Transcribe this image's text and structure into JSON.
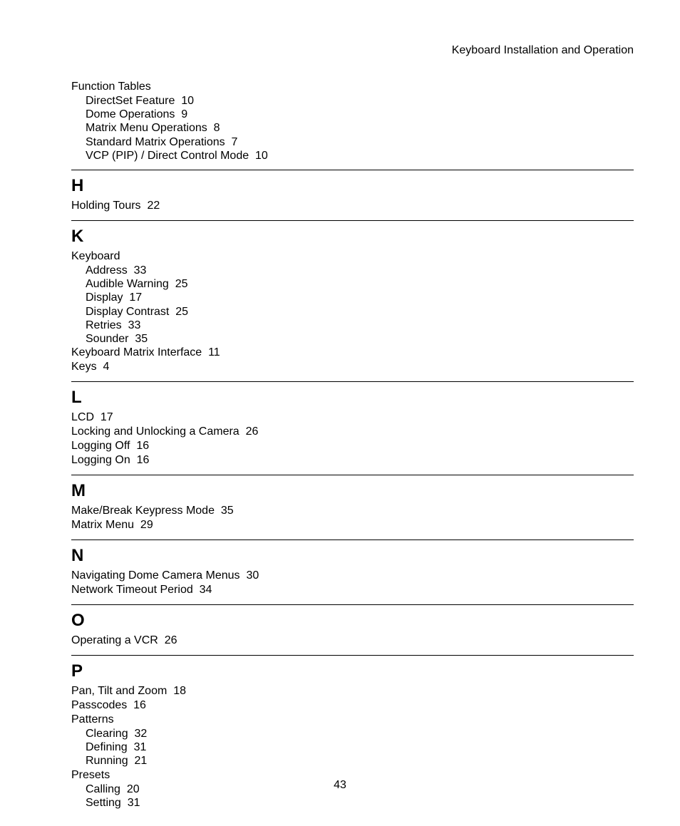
{
  "header": "Keyboard Installation and Operation",
  "pageNumber": "43",
  "top": {
    "title": "Function Tables",
    "subs": [
      {
        "label": "DirectSet Feature",
        "page": "10"
      },
      {
        "label": "Dome Operations",
        "page": "9"
      },
      {
        "label": "Matrix Menu Operations",
        "page": "8"
      },
      {
        "label": "Standard Matrix Operations",
        "page": "7"
      },
      {
        "label": "VCP (PIP) / Direct Control Mode",
        "page": "10"
      }
    ]
  },
  "sections": {
    "H": {
      "letter": "H",
      "entries": [
        {
          "label": "Holding Tours",
          "page": "22"
        }
      ]
    },
    "K": {
      "letter": "K",
      "entries": [
        {
          "label": "Keyboard",
          "subs": [
            {
              "label": "Address",
              "page": "33"
            },
            {
              "label": "Audible Warning",
              "page": "25"
            },
            {
              "label": "Display",
              "page": "17"
            },
            {
              "label": "Display Contrast",
              "page": "25"
            },
            {
              "label": "Retries",
              "page": "33"
            },
            {
              "label": "Sounder",
              "page": "35"
            }
          ]
        },
        {
          "label": "Keyboard Matrix Interface",
          "page": "11"
        },
        {
          "label": "Keys",
          "page": "4"
        }
      ]
    },
    "L": {
      "letter": "L",
      "entries": [
        {
          "label": "LCD",
          "page": "17"
        },
        {
          "label": "Locking and Unlocking a Camera",
          "page": "26"
        },
        {
          "label": "Logging Off",
          "page": "16"
        },
        {
          "label": "Logging On",
          "page": "16"
        }
      ]
    },
    "M": {
      "letter": "M",
      "entries": [
        {
          "label": "Make/Break Keypress Mode",
          "page": "35"
        },
        {
          "label": "Matrix Menu",
          "page": "29"
        }
      ]
    },
    "N": {
      "letter": "N",
      "entries": [
        {
          "label": "Navigating Dome Camera Menus",
          "page": "30"
        },
        {
          "label": "Network Timeout Period",
          "page": "34"
        }
      ]
    },
    "O": {
      "letter": "O",
      "entries": [
        {
          "label": "Operating a VCR",
          "page": "26"
        }
      ]
    },
    "P": {
      "letter": "P",
      "entries": [
        {
          "label": "Pan, Tilt and Zoom",
          "page": "18"
        },
        {
          "label": "Passcodes",
          "page": "16"
        },
        {
          "label": "Patterns",
          "subs": [
            {
              "label": "Clearing",
              "page": "32"
            },
            {
              "label": "Defining",
              "page": "31"
            },
            {
              "label": "Running",
              "page": "21"
            }
          ]
        },
        {
          "label": "Presets",
          "subs": [
            {
              "label": "Calling",
              "page": "20"
            },
            {
              "label": "Setting",
              "page": "31"
            }
          ]
        }
      ]
    }
  }
}
